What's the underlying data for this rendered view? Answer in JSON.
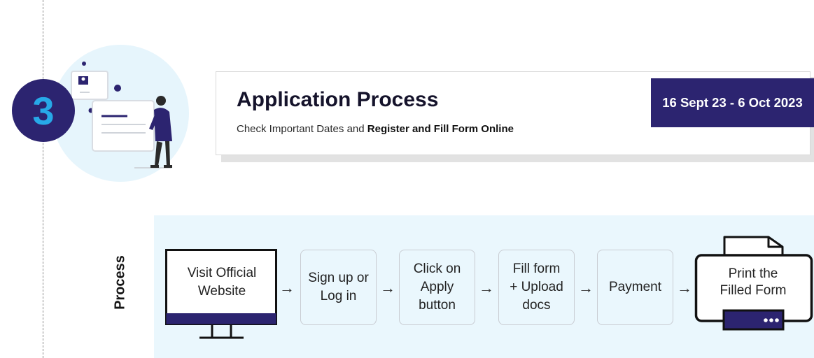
{
  "step": {
    "number": "3"
  },
  "header": {
    "title": "Application Process",
    "subtitle_prefix": "Check Important Dates and ",
    "subtitle_bold": "Register and Fill Form Online",
    "dates": "16 Sept 23 - 6 Oct 2023"
  },
  "process": {
    "label": "Process",
    "steps": [
      {
        "label": "Visit Official\nWebsite",
        "icon": "monitor-icon"
      },
      {
        "label": "Sign up or\nLog in"
      },
      {
        "label": "Click on\nApply\nbutton"
      },
      {
        "label": "Fill form\n+ Upload\ndocs"
      },
      {
        "label": "Payment"
      },
      {
        "label": "Print the\nFilled Form",
        "icon": "printer-icon"
      }
    ],
    "arrow": "→"
  },
  "colors": {
    "primary": "#2c2470",
    "accent_number": "#27a9e8",
    "panel_bg": "#eaf7fd",
    "illustration_circle": "#e6f5fc"
  }
}
